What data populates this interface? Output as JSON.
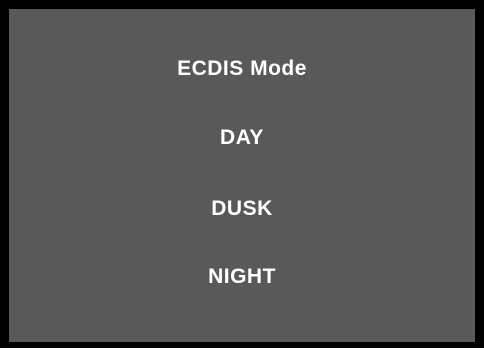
{
  "panel": {
    "title": "ECDIS Mode",
    "options": [
      "DAY",
      "DUSK",
      "NIGHT"
    ]
  },
  "colors": {
    "background": "#595959",
    "border": "#000000",
    "text": "#ffffff"
  }
}
